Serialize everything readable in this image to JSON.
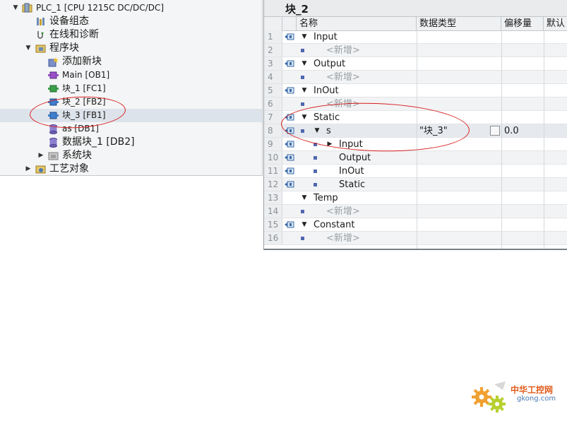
{
  "tree": {
    "items": [
      {
        "label": "PLC_1 [CPU 1215C DC/DC/DC]",
        "icon": "plc-folder-icon",
        "expanded": true
      },
      {
        "label": "设备组态",
        "icon": "device-config-icon"
      },
      {
        "label": "在线和诊断",
        "icon": "online-diagnostics-icon"
      },
      {
        "label": "程序块",
        "icon": "program-blocks-folder-icon",
        "expanded": true
      },
      {
        "label": "添加新块",
        "icon": "add-new-block-icon"
      },
      {
        "label": "Main [OB1]",
        "icon": "ob-block-icon"
      },
      {
        "label": "块_1 [FC1]",
        "icon": "fc-block-icon"
      },
      {
        "label": "块_2 [FB2]",
        "icon": "fb-block-icon"
      },
      {
        "label": "块_3 [FB1]",
        "icon": "fb-block-icon",
        "selected": true
      },
      {
        "label": "as [DB1]",
        "icon": "db-block-icon"
      },
      {
        "label": "数据块_1 [DB2]",
        "icon": "db-block-icon"
      },
      {
        "label": "系统块",
        "icon": "system-blocks-folder-icon",
        "expanded": false
      },
      {
        "label": "工艺对象",
        "icon": "technology-objects-folder-icon",
        "expanded": false
      }
    ]
  },
  "editor": {
    "title": "块_2",
    "columns": [
      "名称",
      "数据类型",
      "偏移量",
      "默认"
    ],
    "rows": [
      {
        "num": "1",
        "name": "Input",
        "type": "",
        "offset": ""
      },
      {
        "num": "2",
        "name": "<新增>",
        "type": "",
        "offset": ""
      },
      {
        "num": "3",
        "name": "Output",
        "type": "",
        "offset": ""
      },
      {
        "num": "4",
        "name": "<新增>",
        "type": "",
        "offset": ""
      },
      {
        "num": "5",
        "name": "InOut",
        "type": "",
        "offset": ""
      },
      {
        "num": "6",
        "name": "<新增>",
        "type": "",
        "offset": ""
      },
      {
        "num": "7",
        "name": "Static",
        "type": "",
        "offset": ""
      },
      {
        "num": "8",
        "name": "s",
        "type": "\"块_3\"",
        "offset": "0.0"
      },
      {
        "num": "9",
        "name": "Input",
        "type": "",
        "offset": ""
      },
      {
        "num": "10",
        "name": "Output",
        "type": "",
        "offset": ""
      },
      {
        "num": "11",
        "name": "InOut",
        "type": "",
        "offset": ""
      },
      {
        "num": "12",
        "name": "Static",
        "type": "",
        "offset": ""
      },
      {
        "num": "13",
        "name": "Temp",
        "type": "",
        "offset": ""
      },
      {
        "num": "14",
        "name": "<新增>",
        "type": "",
        "offset": ""
      },
      {
        "num": "15",
        "name": "Constant",
        "type": "",
        "offset": ""
      },
      {
        "num": "16",
        "name": "<新增>",
        "type": "",
        "offset": ""
      }
    ]
  },
  "watermark": {
    "cn": "中华工控网",
    "en": "gkong.com"
  },
  "colors": {
    "annotation": "#d81e1e",
    "selection": "#dde3ea",
    "accent": "#5068b0"
  }
}
